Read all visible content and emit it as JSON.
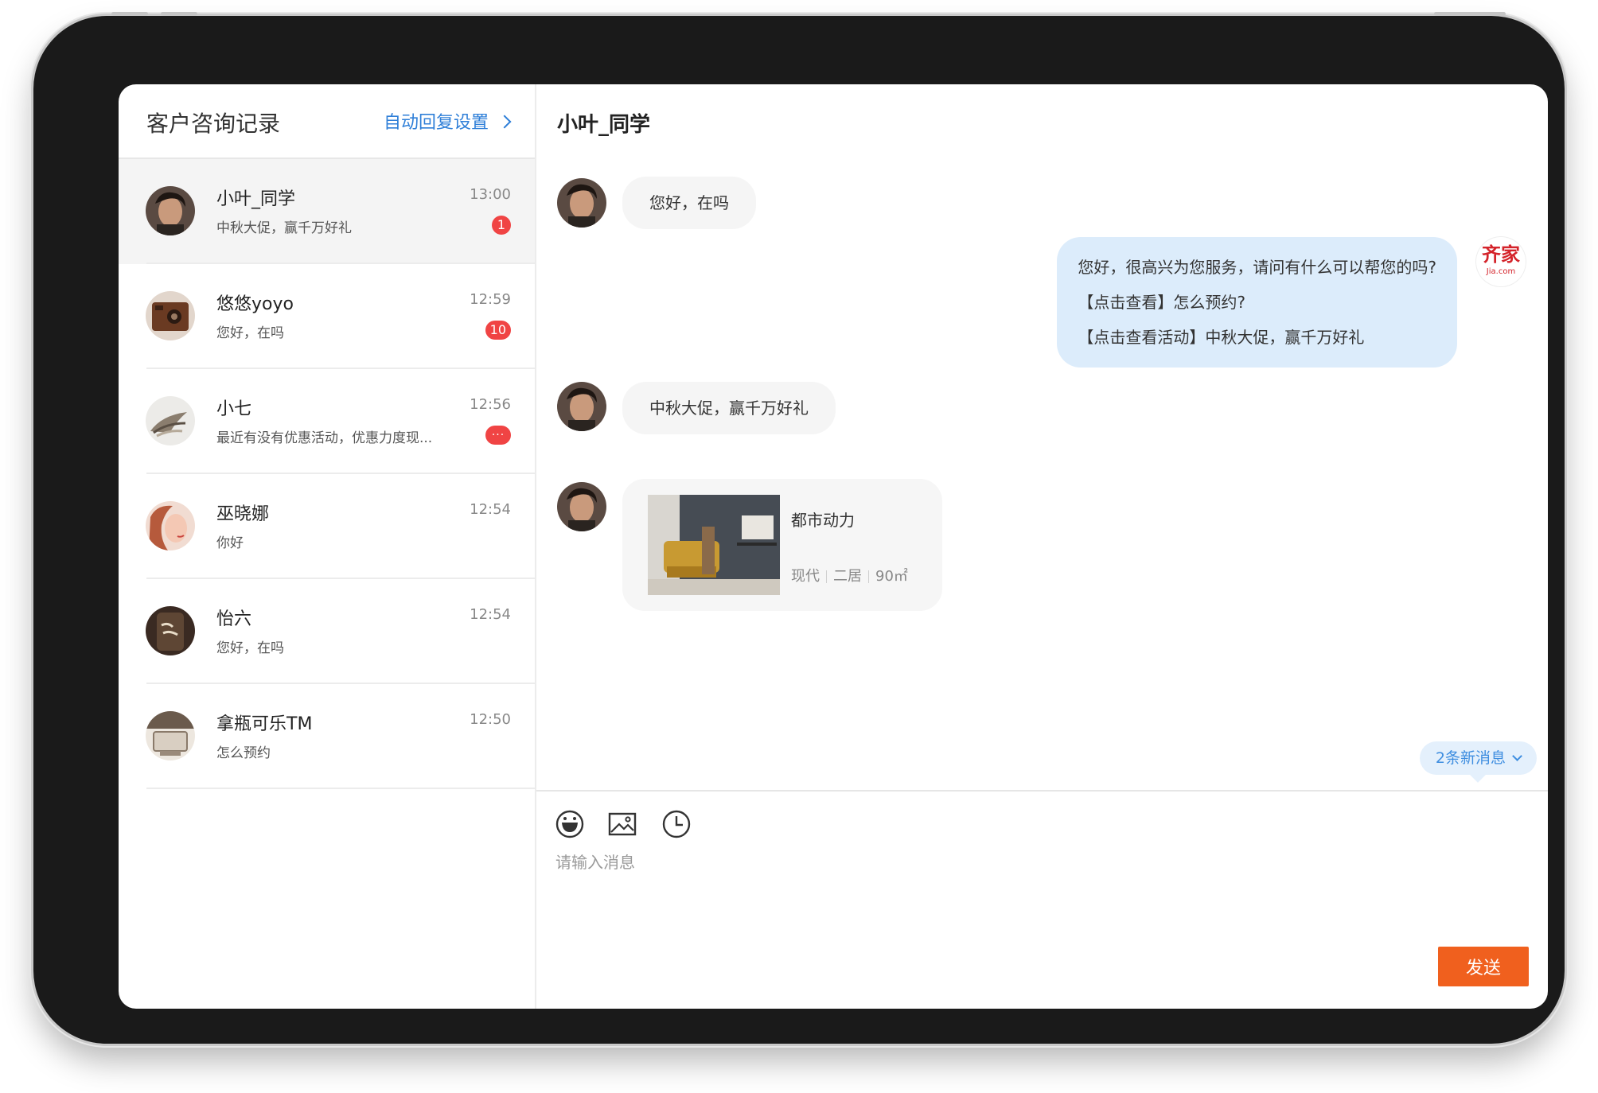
{
  "left": {
    "title": "客户咨询记录",
    "auto_reply_label": "自动回复设置",
    "conversations": [
      {
        "name": "小叶_同学",
        "time": "13:00",
        "preview": "中秋大促，赢千万好礼",
        "badge": "1"
      },
      {
        "name": "悠悠yoyo",
        "time": "12:59",
        "preview": "您好，在吗",
        "badge": "10"
      },
      {
        "name": "小七",
        "time": "12:56",
        "preview": "最近有没有优惠活动，优惠力度现...",
        "badge": "···"
      },
      {
        "name": "巫晓娜",
        "time": "12:54",
        "preview": "你好",
        "badge": ""
      },
      {
        "name": "怡六",
        "time": "12:54",
        "preview": "您好，在吗",
        "badge": ""
      },
      {
        "name": "拿瓶可乐TM",
        "time": "12:50",
        "preview": "怎么预约",
        "badge": ""
      }
    ]
  },
  "chat": {
    "title": "小叶_同学",
    "messages": [
      {
        "from": "customer",
        "text": "您好，在吗"
      },
      {
        "from": "agent",
        "lines": [
          "您好，很高兴为您服务，请问有什么可以帮您的吗?",
          "【点击查看】怎么预约?",
          "【点击查看活动】中秋大促，赢千万好礼"
        ]
      },
      {
        "from": "customer",
        "text": "中秋大促，赢千万好礼"
      }
    ],
    "card": {
      "title": "都市动力",
      "tags": [
        "现代",
        "二居",
        "90㎡"
      ]
    },
    "brand": {
      "logo_text": "齐家",
      "logo_sub": "Jia.com"
    },
    "new_messages_label": "2条新消息",
    "input_placeholder": "请输入消息",
    "send_label": "发送"
  },
  "icons": {
    "emoji": "emoji-icon",
    "image": "image-icon",
    "history": "clock-icon"
  },
  "colors": {
    "accent_blue": "#2f7fd8",
    "send_orange": "#f0601e",
    "badge_red": "#f04444",
    "agent_bubble": "#dcecfb"
  }
}
